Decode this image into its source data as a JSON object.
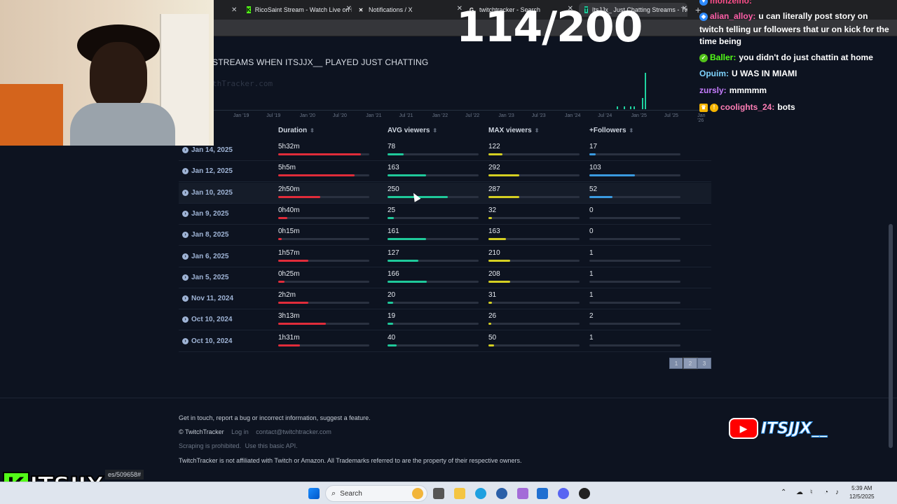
{
  "browser": {
    "tabs": [
      {
        "title": "RicoSaint Stream - Watch Live on K",
        "icon": "kick-icon"
      },
      {
        "title": "Notifications / X",
        "icon": "x-icon"
      },
      {
        "title": "twitchtracker - Search",
        "icon": "google-icon"
      },
      {
        "title": "ItsJJx_ Just Chatting Streams - Tw",
        "icon": "twitchtracker-icon"
      }
    ],
    "status_url": "es/509658#"
  },
  "counter": "114/200",
  "section_title": "STREAMS WHEN ITSJJX__ PLAYED JUST CHATTING",
  "watermark": "thTracker.com",
  "chart_data": {
    "type": "bar",
    "x_ticks": [
      "Jan '19",
      "Jul '19",
      "Jan '20",
      "Jul '20",
      "Jan '21",
      "Jul '21",
      "Jan '22",
      "Jul '22",
      "Jan '23",
      "Jul '23",
      "Jan '24",
      "Jul '24",
      "Jan '25",
      "Jul '25",
      "Jan '26"
    ],
    "grid": false,
    "bar_color": "#1fd3a0"
  },
  "table": {
    "headers": [
      "Duration",
      "AVG viewers",
      "MAX viewers",
      "+Followers"
    ],
    "rows": [
      {
        "date": "Jan 14, 2025",
        "duration": "5h32m",
        "avg": "78",
        "max": "122",
        "followers": "17",
        "dur_frac": 0.91,
        "avg_frac": 0.18,
        "max_frac": 0.15,
        "fol_frac": 0.07
      },
      {
        "date": "Jan 12, 2025",
        "duration": "5h5m",
        "avg": "163",
        "max": "292",
        "followers": "103",
        "dur_frac": 0.84,
        "avg_frac": 0.42,
        "max_frac": 0.34,
        "fol_frac": 0.5
      },
      {
        "date": "Jan 10, 2025",
        "duration": "2h50m",
        "avg": "250",
        "max": "287",
        "followers": "52",
        "dur_frac": 0.46,
        "avg_frac": 0.66,
        "max_frac": 0.34,
        "fol_frac": 0.25
      },
      {
        "date": "Jan 9, 2025",
        "duration": "0h40m",
        "avg": "25",
        "max": "32",
        "followers": "0",
        "dur_frac": 0.1,
        "avg_frac": 0.07,
        "max_frac": 0.04,
        "fol_frac": 0.0
      },
      {
        "date": "Jan 8, 2025",
        "duration": "0h15m",
        "avg": "161",
        "max": "163",
        "followers": "0",
        "dur_frac": 0.04,
        "avg_frac": 0.42,
        "max_frac": 0.19,
        "fol_frac": 0.0
      },
      {
        "date": "Jan 6, 2025",
        "duration": "1h57m",
        "avg": "127",
        "max": "210",
        "followers": "1",
        "dur_frac": 0.33,
        "avg_frac": 0.34,
        "max_frac": 0.24,
        "fol_frac": 0.0
      },
      {
        "date": "Jan 5, 2025",
        "duration": "0h25m",
        "avg": "166",
        "max": "208",
        "followers": "1",
        "dur_frac": 0.07,
        "avg_frac": 0.43,
        "max_frac": 0.24,
        "fol_frac": 0.0
      },
      {
        "date": "Nov 11, 2024",
        "duration": "2h2m",
        "avg": "20",
        "max": "31",
        "followers": "1",
        "dur_frac": 0.33,
        "avg_frac": 0.06,
        "max_frac": 0.04,
        "fol_frac": 0.0
      },
      {
        "date": "Oct 10, 2024",
        "duration": "3h13m",
        "avg": "19",
        "max": "26",
        "followers": "2",
        "dur_frac": 0.52,
        "avg_frac": 0.06,
        "max_frac": 0.03,
        "fol_frac": 0.0
      },
      {
        "date": "Oct 10, 2024",
        "duration": "1h31m",
        "avg": "40",
        "max": "50",
        "followers": "1",
        "dur_frac": 0.24,
        "avg_frac": 0.1,
        "max_frac": 0.06,
        "fol_frac": 0.0
      }
    ],
    "colors": {
      "duration": "#e02c3a",
      "avg": "#1fc99a",
      "max": "#d4cf22",
      "followers": "#3a9ae0"
    }
  },
  "pagination": {
    "pages": [
      "1",
      "2",
      "3"
    ],
    "current": "2"
  },
  "footer": {
    "line1": "Get in touch, report a bug or incorrect information, suggest a feature.",
    "brand": "© TwitchTracker",
    "login": "Log in",
    "email": "contact@twitchtracker.com",
    "scraping": "Scraping is prohibited.",
    "api": "Use this basic API.",
    "disclaimer": "TwitchTracker is not affiliated with Twitch or Amazon. All Trademarks referred to are the property of their respective owners."
  },
  "chat": [
    {
      "user": "monzeino:",
      "text": "",
      "color": "#ff4e8a"
    },
    {
      "user": "alian_alloy:",
      "text": "u can literally post story on",
      "color": "#ff5fa8"
    },
    {
      "user": "",
      "text": "twitch telling ur followers that ur on kick for the",
      "color": "#ffffff"
    },
    {
      "user": "",
      "text": "time being",
      "color": "#ffffff"
    },
    {
      "user": "Baller:",
      "text": "you didn't do just chattin at home",
      "color": "#53fc18"
    },
    {
      "user": "Opuim:",
      "text": "U WAS IN MIAMI",
      "color": "#7fd4ff"
    },
    {
      "user": "zursly:",
      "text": "mmmmm",
      "color": "#c77dff"
    },
    {
      "user": "coolights_24:",
      "text": "bots",
      "color": "#ff7eb6"
    }
  ],
  "overlay": {
    "kick_logo_letter": "K",
    "kick_logo_text": "ITSJJX",
    "yt_text": "ITSJJX__"
  },
  "taskbar": {
    "search_label": "Search",
    "time": "5:39 AM",
    "date": "12/5/2025"
  }
}
